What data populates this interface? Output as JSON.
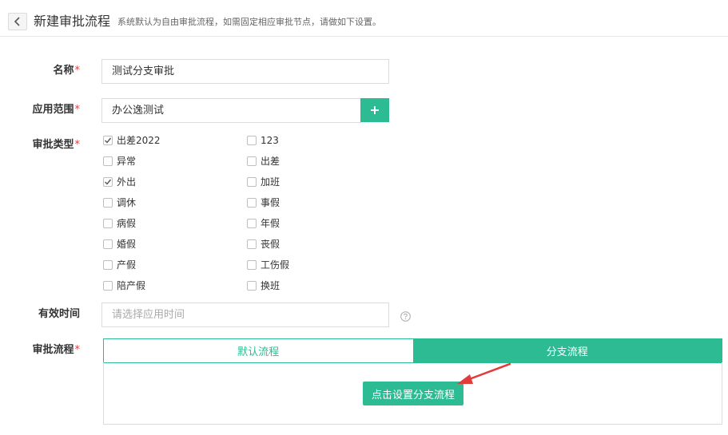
{
  "header": {
    "title": "新建审批流程",
    "description": "系统默认为自由审批流程，如需固定相应审批节点，请做如下设置。"
  },
  "form": {
    "name": {
      "label": "名称",
      "required_mark": "*",
      "value": "测试分支审批"
    },
    "scope": {
      "label": "应用范围",
      "required_mark": "*",
      "value": "办公逸测试"
    },
    "types": {
      "label": "审批类型",
      "required_mark": "*",
      "left_column": [
        {
          "label": "出差2022",
          "checked": true
        },
        {
          "label": "异常",
          "checked": false
        },
        {
          "label": "外出",
          "checked": true
        },
        {
          "label": "调休",
          "checked": false
        },
        {
          "label": "病假",
          "checked": false
        },
        {
          "label": "婚假",
          "checked": false
        },
        {
          "label": "产假",
          "checked": false
        },
        {
          "label": "陪产假",
          "checked": false
        }
      ],
      "right_column": [
        {
          "label": "123",
          "checked": false
        },
        {
          "label": "出差",
          "checked": false
        },
        {
          "label": "加班",
          "checked": false
        },
        {
          "label": "事假",
          "checked": false
        },
        {
          "label": "年假",
          "checked": false
        },
        {
          "label": "丧假",
          "checked": false
        },
        {
          "label": "工伤假",
          "checked": false
        },
        {
          "label": "换班",
          "checked": false
        }
      ]
    },
    "valid_time": {
      "label": "有效时间",
      "placeholder": "请选择应用时间"
    },
    "flow": {
      "label": "审批流程",
      "required_mark": "*",
      "tabs": [
        {
          "label": "默认流程",
          "active": false
        },
        {
          "label": "分支流程",
          "active": true
        }
      ],
      "setup_button": "点击设置分支流程"
    }
  },
  "colors": {
    "accent": "#2dbb93",
    "required": "#e23b3b",
    "arrow": "#e23b3b"
  },
  "icons": {
    "back": "chevron-left-icon",
    "add": "plus-icon",
    "help": "question-circle-icon",
    "check": "check-icon"
  }
}
